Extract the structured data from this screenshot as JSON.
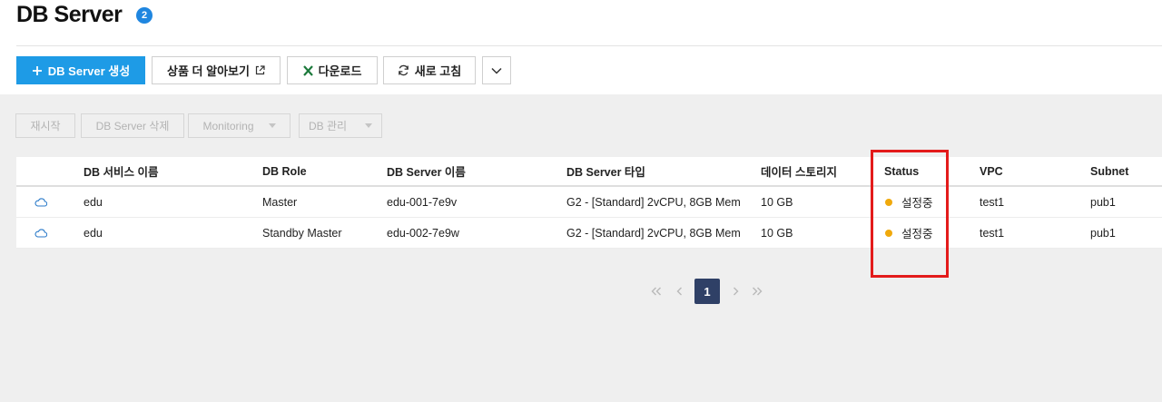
{
  "header": {
    "title": "DB Server",
    "count_badge": "2"
  },
  "toolbar": {
    "create_label": "DB Server 생성",
    "learn_more_label": "상품 더 알아보기",
    "download_label": "다운로드",
    "refresh_label": "새로 고침"
  },
  "actions": {
    "restart_label": "재시작",
    "delete_label": "DB Server 삭제",
    "monitoring_label": "Monitoring",
    "manage_label": "DB 관리"
  },
  "table": {
    "columns": [
      "DB 서비스 이름",
      "DB Role",
      "DB Server 이름",
      "DB Server 타입",
      "데이터 스토리지",
      "Status",
      "VPC",
      "Subnet"
    ],
    "rows": [
      {
        "service": "edu",
        "role": "Master",
        "server": "edu-001-7e9v",
        "type": "G2 - [Standard] 2vCPU, 8GB Mem",
        "storage": "10 GB",
        "status": "설정중",
        "vpc": "test1",
        "subnet": "pub1"
      },
      {
        "service": "edu",
        "role": "Standby Master",
        "server": "edu-002-7e9w",
        "type": "G2 - [Standard] 2vCPU, 8GB Mem",
        "storage": "10 GB",
        "status": "설정중",
        "vpc": "test1",
        "subnet": "pub1"
      }
    ]
  },
  "pagination": {
    "current_page": "1"
  },
  "colors": {
    "primary": "#1e9be6",
    "status_pending": "#f0a90c",
    "highlight": "#e31b1b",
    "page_active": "#2f4066"
  }
}
